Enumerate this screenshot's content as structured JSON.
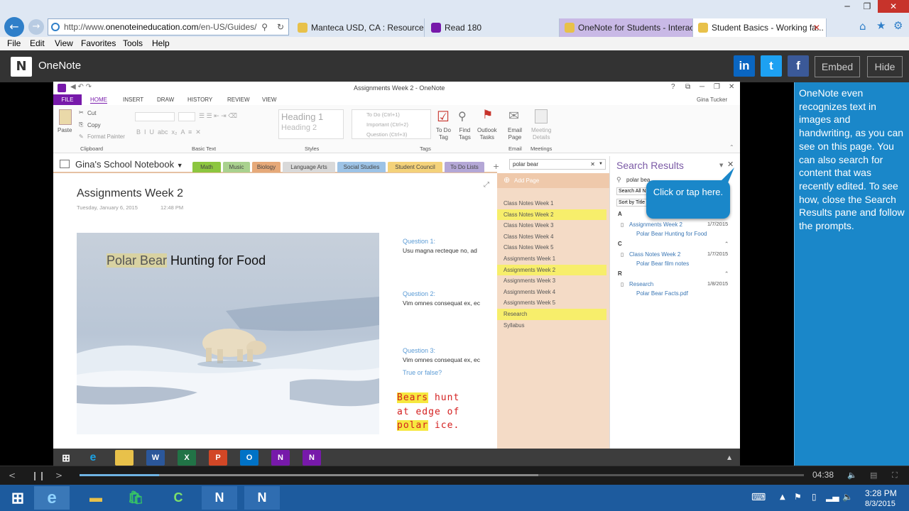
{
  "browser": {
    "url_prefix": "http://www.",
    "url_domain": "onenoteineducation.com",
    "url_rest": "/en-US/Guides/",
    "tabs": [
      {
        "label": "Manteca USD, CA : Resources"
      },
      {
        "label": "Read 180"
      },
      {
        "label": "OneNote for Students - Interac..."
      },
      {
        "label": "Student Basics - Working fa..."
      }
    ],
    "menu": [
      "File",
      "Edit",
      "View",
      "Favorites",
      "Tools",
      "Help"
    ]
  },
  "header": {
    "title": "OneNote",
    "social": [
      "in",
      "t",
      "f"
    ],
    "embed_label": "Embed",
    "hide_label": "Hide"
  },
  "side_panel": {
    "text": "OneNote even recognizes text in images and handwriting, as you can see on this page. You can also search for content that was recently edited. To see how, close the Search Results pane and follow the prompts."
  },
  "onenote": {
    "window_title": "Assignments Week 2 - OneNote",
    "user": "Gina Tucker",
    "ribbon_tabs": [
      "FILE",
      "HOME",
      "INSERT",
      "DRAW",
      "HISTORY",
      "REVIEW",
      "VIEW"
    ],
    "clipboard": {
      "paste": "Paste",
      "cut": "Cut",
      "copy": "Copy",
      "format_painter": "Format Painter",
      "group": "Clipboard"
    },
    "basic_text_group": "Basic Text",
    "styles": {
      "h1": "Heading 1",
      "h2": "Heading 2",
      "group": "Styles"
    },
    "tags": {
      "todo": "To Do (Ctrl+1)",
      "important": "Important (Ctrl+2)",
      "question": "Question (Ctrl+3)",
      "group": "Tags"
    },
    "tag_buttons": [
      {
        "line1": "To Do",
        "line2": "Tag"
      },
      {
        "line1": "Find",
        "line2": "Tags"
      },
      {
        "line1": "Outlook",
        "line2": "Tasks"
      }
    ],
    "email": {
      "line1": "Email",
      "line2": "Page",
      "group": "Email"
    },
    "meetings": {
      "line1": "Meeting",
      "line2": "Details",
      "group": "Meetings"
    },
    "notebook": "Gina's School Notebook",
    "sections": [
      {
        "label": "Math",
        "color": "#8cc63f"
      },
      {
        "label": "Music",
        "color": "#a9d18e"
      },
      {
        "label": "Biology",
        "color": "#e6a979"
      },
      {
        "label": "Language Arts",
        "color": "#d9d9d9"
      },
      {
        "label": "Social Studies",
        "color": "#9dc3e6"
      },
      {
        "label": "Student Council",
        "color": "#f4d27a"
      },
      {
        "label": "To Do Lists",
        "color": "#b4a7d6"
      }
    ],
    "search_query": "polar bear",
    "page": {
      "title": "Assignments Week 2",
      "date": "Tuesday, January 6, 2015",
      "time": "12:48 PM",
      "photo_title_highlight": "Polar Bear",
      "photo_title_rest": " Hunting for Food",
      "questions": [
        {
          "label": "Question 1:",
          "text": "Usu magna recteque no, ad"
        },
        {
          "label": "Question 2:",
          "text": "Vim omnes consequat ex, ec"
        },
        {
          "label": "Question 3:",
          "text": "Vim omnes consequat ex, ec"
        }
      ],
      "true_false": "True or false?",
      "handwriting": [
        {
          "hl": "Bears",
          "rest": " hunt"
        },
        {
          "hl": "",
          "rest": "at edge of"
        },
        {
          "hl": "polar",
          "rest": " ice."
        }
      ]
    },
    "add_page": "Add Page",
    "pages": [
      {
        "label": "Class Notes Week 1",
        "selected": false
      },
      {
        "label": "Class Notes Week 2",
        "selected": true
      },
      {
        "label": "Class Notes Week 3",
        "selected": false
      },
      {
        "label": "Class Notes Week 4",
        "selected": false
      },
      {
        "label": "Class Notes Week 5",
        "selected": false
      },
      {
        "label": "Assignments Week 1",
        "selected": false
      },
      {
        "label": "Assignments Week 2",
        "selected": true
      },
      {
        "label": "Assignments Week 3",
        "selected": false
      },
      {
        "label": "Assignments Week 4",
        "selected": false
      },
      {
        "label": "Assignments Week 5",
        "selected": false
      },
      {
        "label": "Research",
        "selected": true
      },
      {
        "label": "Syllabus",
        "selected": false
      }
    ],
    "search_results": {
      "title": "Search Results",
      "query_short": "polar bea",
      "scope": "Search All N",
      "sort": "Sort by Title",
      "callout": "Click or tap here.",
      "groups": [
        {
          "letter": "A",
          "page": "Assignments Week 2",
          "date": "1/7/2015",
          "hit": "Polar Bear Hunting for Food"
        },
        {
          "letter": "C",
          "page": "Class Notes Week 2",
          "date": "1/7/2015",
          "hit": "Polar Bear film notes"
        },
        {
          "letter": "R",
          "page": "Research",
          "date": "1/8/2015",
          "hit": "Polar Bear Facts.pdf"
        }
      ]
    }
  },
  "player": {
    "time": "04:38",
    "progress": 0.11
  },
  "taskbar": {
    "time": "3:28 PM",
    "date": "8/3/2015"
  }
}
